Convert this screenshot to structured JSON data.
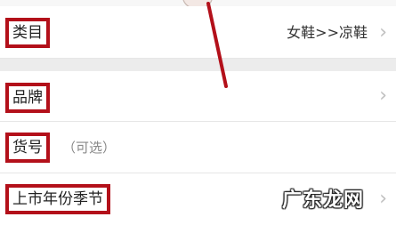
{
  "category": {
    "label": "类目",
    "value": "女鞋>>凉鞋"
  },
  "brand": {
    "label": "品牌"
  },
  "item_number": {
    "label": "货号",
    "hint": "（可选）"
  },
  "season": {
    "label": "上市年份季节"
  },
  "watermark": {
    "text": "广东龙网"
  },
  "icons": {
    "chevron": "chevron-right-icon"
  },
  "colors": {
    "highlight_border": "#b3101a",
    "pointer_line": "#b3101a",
    "section_gap": "#ececec"
  }
}
